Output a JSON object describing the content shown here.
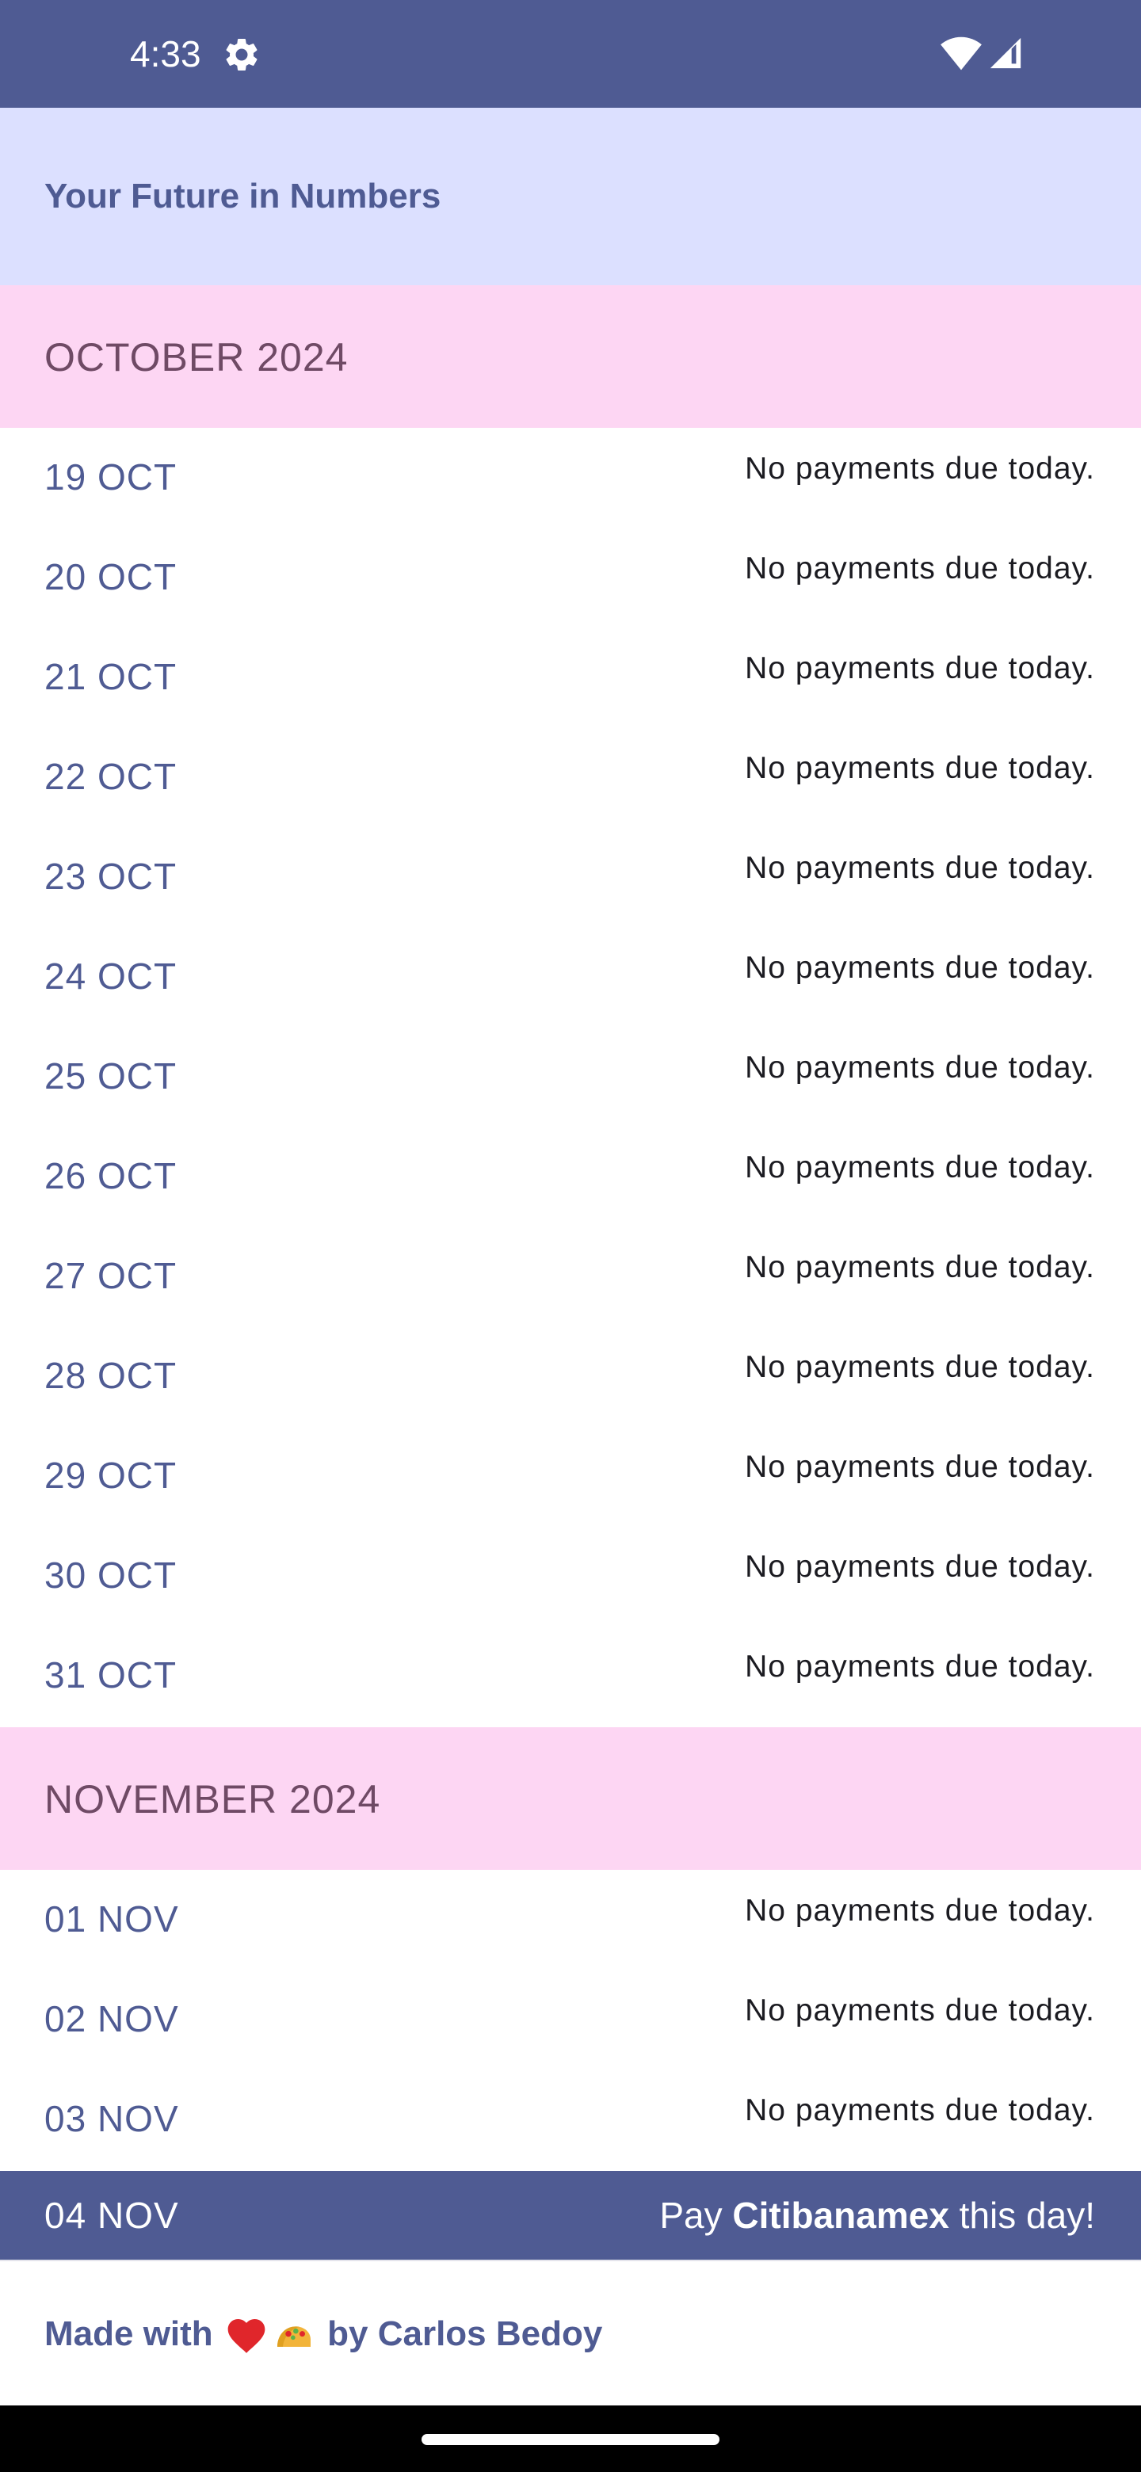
{
  "status_bar": {
    "time": "4:33",
    "settings_icon": "gear-icon",
    "wifi_icon": "wifi-icon",
    "signal_icon": "cell-signal-icon"
  },
  "header": {
    "title": "Your Future in Numbers"
  },
  "months": [
    {
      "label": "OCTOBER 2024",
      "days": [
        {
          "date": "19 OCT",
          "status": "No payments due today."
        },
        {
          "date": "20 OCT",
          "status": "No payments due today."
        },
        {
          "date": "21 OCT",
          "status": "No payments due today."
        },
        {
          "date": "22 OCT",
          "status": "No payments due today."
        },
        {
          "date": "23 OCT",
          "status": "No payments due today."
        },
        {
          "date": "24 OCT",
          "status": "No payments due today."
        },
        {
          "date": "25 OCT",
          "status": "No payments due today."
        },
        {
          "date": "26 OCT",
          "status": "No payments due today."
        },
        {
          "date": "27 OCT",
          "status": "No payments due today."
        },
        {
          "date": "28 OCT",
          "status": "No payments due today."
        },
        {
          "date": "29 OCT",
          "status": "No payments due today."
        },
        {
          "date": "30 OCT",
          "status": "No payments due today."
        },
        {
          "date": "31 OCT",
          "status": "No payments due today."
        }
      ]
    },
    {
      "label": "NOVEMBER 2024",
      "days": [
        {
          "date": "01 NOV",
          "status": "No payments due today."
        },
        {
          "date": "02 NOV",
          "status": "No payments due today."
        },
        {
          "date": "03 NOV",
          "status": "No payments due today."
        }
      ]
    }
  ],
  "payment_day": {
    "date": "04 NOV",
    "prefix": "Pay ",
    "bank": "Citibanamex",
    "suffix": " this day!"
  },
  "footer": {
    "prefix": "Made with ",
    "heart_icon": "heart-icon",
    "taco_icon": "taco-icon",
    "suffix": " by Carlos Bedoy"
  },
  "colors": {
    "primary": "#4f5b93",
    "header_bg": "#dce0ff",
    "month_bg": "#fdd6f3",
    "month_text": "#6f4a65"
  }
}
